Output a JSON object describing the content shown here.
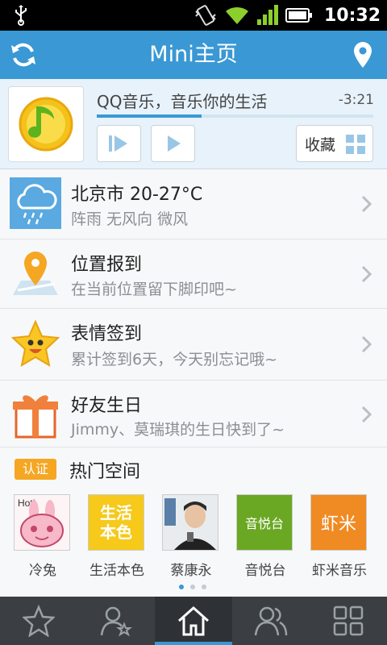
{
  "status_bar": {
    "time": "10:32"
  },
  "header": {
    "title": "Mini主页"
  },
  "player": {
    "song_title": "QQ音乐，音乐你的生活",
    "remaining": "-3:21",
    "progress": 0.38,
    "favorite_label": "收藏"
  },
  "rows": [
    {
      "title": "北京市 20-27°C",
      "subtitle": "阵雨 无风向 微风",
      "icon": "weather-rain-icon"
    },
    {
      "title": "位置报到",
      "subtitle": "在当前位置留下脚印吧~",
      "icon": "location-pin-icon"
    },
    {
      "title": "表情签到",
      "subtitle": "累计签到6天，今天别忘记哦~",
      "icon": "smiley-star-icon"
    },
    {
      "title": "好友生日",
      "subtitle": "Jimmy、莫瑞琪的生日快到了~",
      "icon": "gift-icon"
    }
  ],
  "hot": {
    "badge": "认证",
    "title": "热门空间",
    "spaces": [
      {
        "label": "冷兔",
        "thumb_text": "Hot!"
      },
      {
        "label": "生活本色",
        "thumb_text": "生活本色"
      },
      {
        "label": "蔡康永",
        "thumb_text": ""
      },
      {
        "label": "音悦台",
        "thumb_text": "音悦台"
      },
      {
        "label": "虾米音乐",
        "thumb_text": "虾米"
      }
    ],
    "page_count": 3,
    "current_page": 1
  },
  "tabs": [
    {
      "name": "favorites",
      "icon": "star-icon"
    },
    {
      "name": "friends-update",
      "icon": "person-star-icon"
    },
    {
      "name": "home",
      "icon": "home-icon"
    },
    {
      "name": "contacts",
      "icon": "contacts-icon"
    },
    {
      "name": "apps",
      "icon": "apps-grid-icon"
    }
  ],
  "colors": {
    "accent": "#3a98d4",
    "tabbar": "#3b3f43",
    "badge": "#f5a623"
  }
}
